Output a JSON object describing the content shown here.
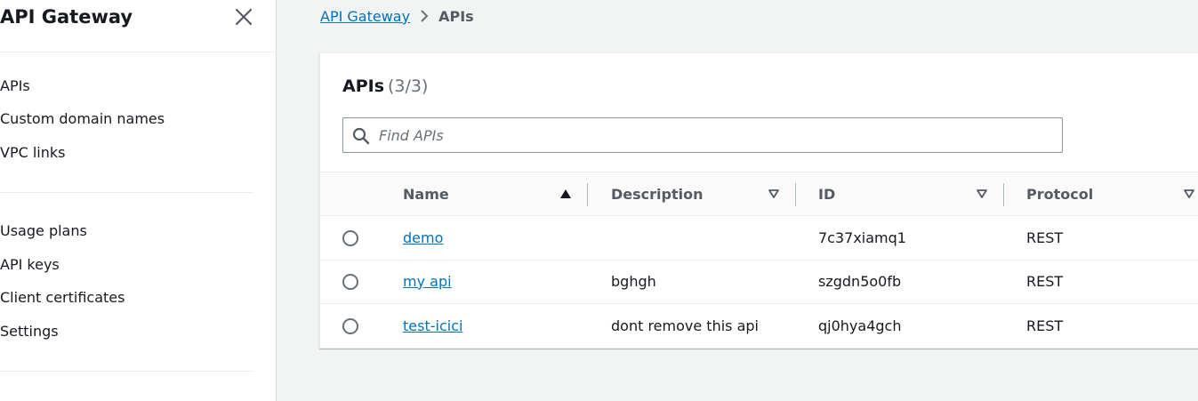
{
  "sidebar": {
    "title": "API Gateway",
    "groups": [
      {
        "items": [
          {
            "label": "APIs",
            "active": true
          },
          {
            "label": "Custom domain names",
            "active": false
          },
          {
            "label": "VPC links",
            "active": false
          }
        ]
      },
      {
        "items": [
          {
            "label": "Usage plans",
            "active": false
          },
          {
            "label": "API keys",
            "active": false
          },
          {
            "label": "Client certificates",
            "active": false
          },
          {
            "label": "Settings",
            "active": false
          }
        ]
      }
    ]
  },
  "breadcrumb": {
    "items": [
      "API Gateway",
      "APIs"
    ]
  },
  "panel": {
    "title": "APIs",
    "count": "(3/3)",
    "search_placeholder": "Find APIs"
  },
  "table": {
    "columns": [
      {
        "label": "Name",
        "sort": "ascending"
      },
      {
        "label": "Description",
        "sort": "none"
      },
      {
        "label": "ID",
        "sort": "none"
      },
      {
        "label": "Protocol",
        "sort": "none"
      }
    ],
    "rows": [
      {
        "name": "demo",
        "description": "",
        "id": "7c37xiamq1",
        "protocol": "REST",
        "selected": false
      },
      {
        "name": "my api",
        "description": "bghgh",
        "id": "szgdn5o0fb",
        "protocol": "REST",
        "selected": false
      },
      {
        "name": "test-icici",
        "description": "dont remove this api",
        "id": "qj0hya4gch",
        "protocol": "REST",
        "selected": false
      }
    ]
  },
  "colors": {
    "accent_link": "#0073bb",
    "text": "#16191f",
    "muted": "#545b64",
    "page_bg": "#f2f3f3"
  },
  "icons": {
    "close": "close-icon",
    "search": "search-icon",
    "breadcrumb_separator": "chevron-right-icon",
    "sort_ascending": "sort-ascending-icon",
    "sort_unsorted": "sort-unsorted-icon"
  }
}
